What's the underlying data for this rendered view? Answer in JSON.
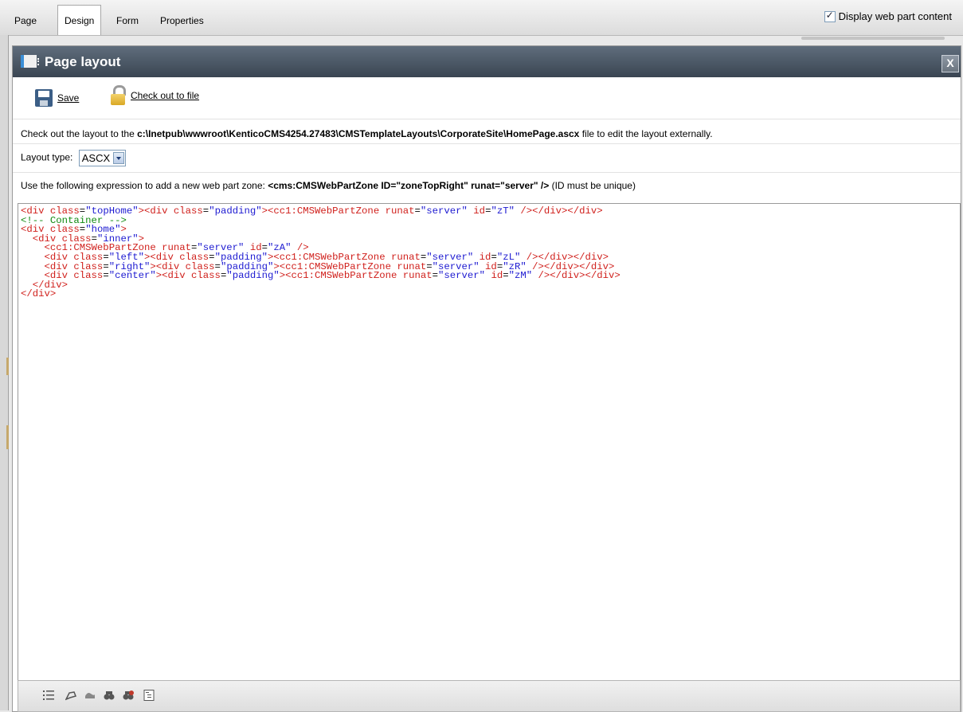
{
  "tabs": [
    "Page",
    "Design",
    "Form",
    "Properties"
  ],
  "active_tab": "Design",
  "display_web_part_content": {
    "label": "Display web part content",
    "checked": true
  },
  "dialog": {
    "title": "Page layout",
    "close_label": "X",
    "toolbar": {
      "save_label": "Save",
      "checkout_label": "Check out to file"
    },
    "checkout_prefix": "Check out the layout to the ",
    "checkout_path": "c:\\Inetpub\\wwwroot\\KenticoCMS4254.27483\\CMSTemplateLayouts\\CorporateSite\\HomePage.ascx",
    "checkout_suffix": " file to edit the layout externally.",
    "layout_type_label": "Layout type:",
    "layout_type_value": "ASCX",
    "zone_prefix": "Use the following expression to add a new web part zone: ",
    "zone_expression": "<cms:CMSWebPartZone ID=\"zoneTopRight\" runat=\"server\" />",
    "zone_suffix": " (ID must be unique)"
  },
  "code_lines": [
    "<div class=\"topHome\"><div class=\"padding\"><cc1:CMSWebPartZone runat=\"server\" id=\"zT\" /></div></div>",
    "<!-- Container -->",
    "<div class=\"home\">",
    "  <div class=\"inner\">",
    "    <cc1:CMSWebPartZone runat=\"server\" id=\"zA\" />",
    "    <div class=\"left\"><div class=\"padding\"><cc1:CMSWebPartZone runat=\"server\" id=\"zL\" /></div></div>",
    "    <div class=\"right\"><div class=\"padding\"><cc1:CMSWebPartZone runat=\"server\" id=\"zR\" /></div></div>",
    "    <div class=\"center\"><div class=\"padding\"><cc1:CMSWebPartZone runat=\"server\" id=\"zM\" /></div></div>",
    "  </div>",
    "</div>"
  ],
  "editor_tools": [
    "line-numbers-icon",
    "highlight-icon",
    "wrap-icon",
    "find-icon",
    "replace-icon",
    "indent-icon"
  ],
  "colors": {
    "tag": "#d0201c",
    "attr_value": "#1d1ad1",
    "comment": "#118a11",
    "titlebar": "#4a5562"
  }
}
